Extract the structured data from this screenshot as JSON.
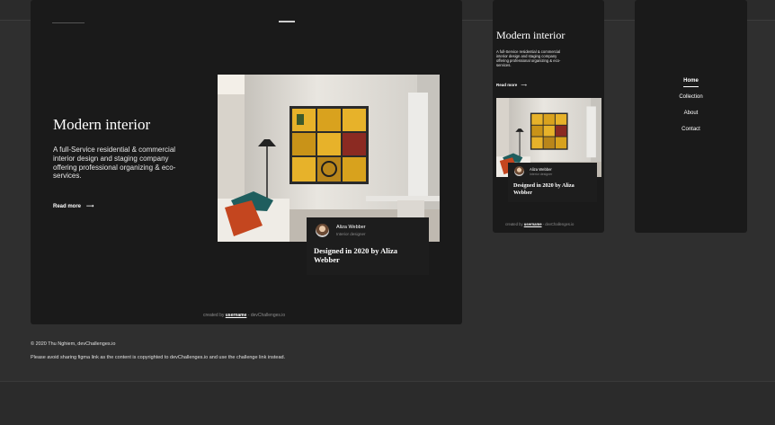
{
  "desktop": {
    "title": "Modern interior",
    "description": "A full-Service residential & commercial interior design and staging company offering professional organizing & eco-services.",
    "read_more": "Read more",
    "card": {
      "name": "Aliza Webber",
      "role": "Interior designer",
      "designed_title": "Designed in 2020 by Aliza Webber"
    },
    "credit": {
      "prefix": "created by",
      "username": "username",
      "suffix": "- devChallenges.io"
    }
  },
  "mobile": {
    "title": "Modern interior",
    "description": "A full-Service residential & commercial interior design and staging company offering professional organizing & eco-services.",
    "read_more": "Read more",
    "card": {
      "name": "Aliza Webber",
      "role": "Interior designer",
      "designed_title": "Designed in 2020 by Aliza Webber"
    },
    "credit": {
      "prefix": "created by",
      "username": "username",
      "suffix": "- devChallenges.io"
    }
  },
  "menu": {
    "items": [
      {
        "label": "Home",
        "active": true
      },
      {
        "label": "Collection",
        "active": false
      },
      {
        "label": "About",
        "active": false
      },
      {
        "label": "Contact",
        "active": false
      }
    ]
  },
  "footer": {
    "copyright": "© 2020 Thu Nghiem, devChallenges.io",
    "notice": "Please avoid sharing figma link as the content is copyrighted to devChallenges.io and use the challenge link instead."
  },
  "colors": {
    "page_bg": "#2f2f2f",
    "frame_bg": "#1a1a1a",
    "card_bg": "#1d1d1d",
    "text": "#ffffff",
    "muted": "#8d8d8d",
    "tile_yellow": "#e7b22a"
  },
  "icons": {
    "arrow": "arrow-right-icon"
  }
}
